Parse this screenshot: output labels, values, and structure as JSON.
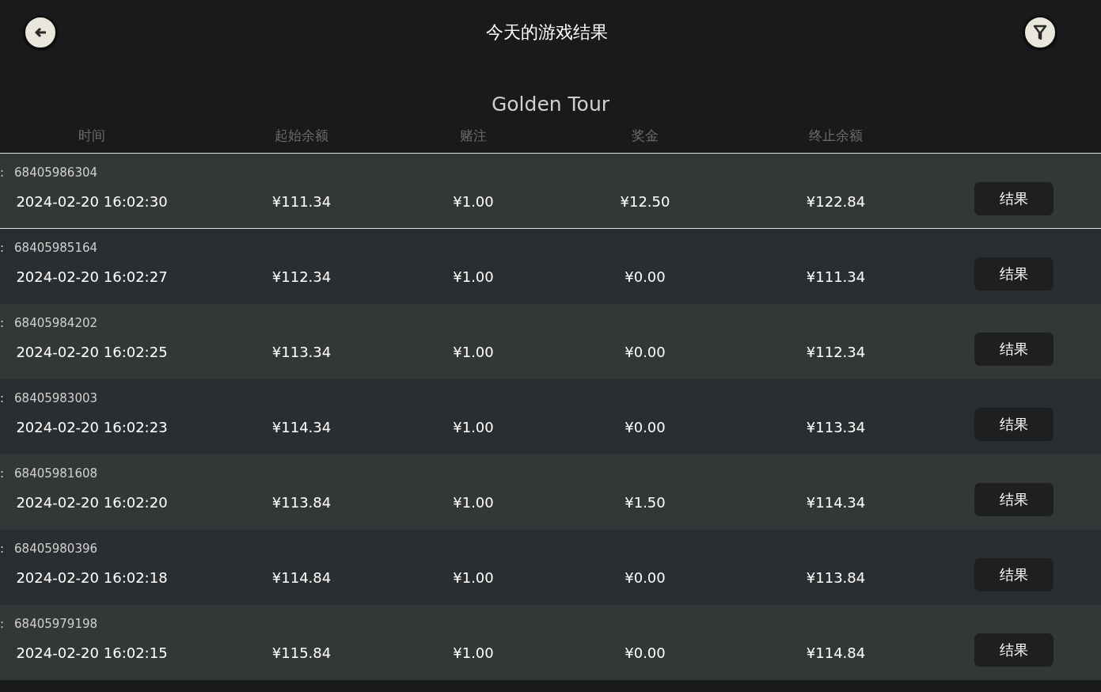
{
  "header": {
    "title": "今天的游戏结果"
  },
  "game_name": "Golden Tour",
  "table": {
    "columns": [
      "时间",
      "起始余额",
      "赌注",
      "奖金",
      "终止余额"
    ],
    "rows": [
      {
        "id_label": ":",
        "id": "68405986304",
        "time": "2024-02-20 16:02:30",
        "start": "¥111.34",
        "bet": "¥1.00",
        "win": "¥12.50",
        "end": "¥122.84",
        "button": "结果",
        "selected": true
      },
      {
        "id_label": ":",
        "id": "68405985164",
        "time": "2024-02-20 16:02:27",
        "start": "¥112.34",
        "bet": "¥1.00",
        "win": "¥0.00",
        "end": "¥111.34",
        "button": "结果",
        "selected": false
      },
      {
        "id_label": ":",
        "id": "68405984202",
        "time": "2024-02-20 16:02:25",
        "start": "¥113.34",
        "bet": "¥1.00",
        "win": "¥0.00",
        "end": "¥112.34",
        "button": "结果",
        "selected": false
      },
      {
        "id_label": ":",
        "id": "68405983003",
        "time": "2024-02-20 16:02:23",
        "start": "¥114.34",
        "bet": "¥1.00",
        "win": "¥0.00",
        "end": "¥113.34",
        "button": "结果",
        "selected": false
      },
      {
        "id_label": ":",
        "id": "68405981608",
        "time": "2024-02-20 16:02:20",
        "start": "¥113.84",
        "bet": "¥1.00",
        "win": "¥1.50",
        "end": "¥114.34",
        "button": "结果",
        "selected": false
      },
      {
        "id_label": ":",
        "id": "68405980396",
        "time": "2024-02-20 16:02:18",
        "start": "¥114.84",
        "bet": "¥1.00",
        "win": "¥0.00",
        "end": "¥113.84",
        "button": "结果",
        "selected": false
      },
      {
        "id_label": ":",
        "id": "68405979198",
        "time": "2024-02-20 16:02:15",
        "start": "¥115.84",
        "bet": "¥1.00",
        "win": "¥0.00",
        "end": "¥114.84",
        "button": "结果",
        "selected": false
      }
    ]
  }
}
